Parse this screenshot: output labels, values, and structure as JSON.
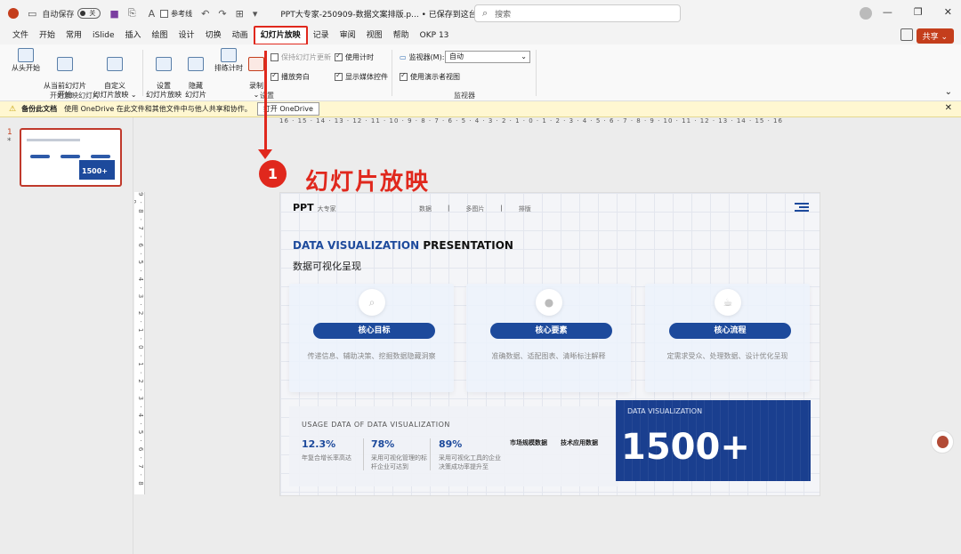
{
  "titlebar": {
    "autosave_label": "自动保存",
    "autosave_state": "关",
    "reference_line_label": "参考线",
    "doc_title": "PPT大专家-250909-数据文案排版.p... • 已保存到这台电脑 ⌄",
    "search_placeholder": "搜索"
  },
  "menu": {
    "tabs": [
      "文件",
      "开始",
      "常用",
      "iSlide",
      "插入",
      "绘图",
      "设计",
      "切换",
      "动画",
      "幻灯片放映",
      "记录",
      "审阅",
      "视图",
      "帮助",
      "OKP 13"
    ],
    "active": "幻灯片放映",
    "share_label": "共享"
  },
  "ribbon": {
    "from_start": "从头开始",
    "from_current": "从当前幻灯片\n开始",
    "custom_show": "自定义\n幻灯片放映 ⌄",
    "group_start": "开始放映幻灯片",
    "setup_show": "设置\n幻灯片放映",
    "hide_slide": "隐藏\n幻灯片",
    "rehearse": "排练计时",
    "record": "录制\n⌄",
    "keep_updated": "保持幻灯片更新",
    "play_narration": "播放旁白",
    "use_timing": "使用计时",
    "show_media": "显示媒体控件",
    "group_setup": "设置",
    "monitor_label": "监视器(M):",
    "monitor_value": "自动",
    "presenter_view": "使用演示者视图",
    "group_monitor": "监视器"
  },
  "notify": {
    "bold": "备份此文档",
    "text": "使用 OneDrive 在此文件和其他文件中与他人共享和协作。",
    "button": "打开 OneDrive"
  },
  "thumbnails": {
    "number": "1",
    "marker": "*",
    "big_number": "1500+"
  },
  "rulers": {
    "horizontal": "16 · 15 · 14 · 13 · 12 · 11 · 10 · 9 · 8 · 7 · 6 · 5 · 4 · 3 · 2 · 1 · 0 · 1 · 2 · 3 · 4 · 5 · 6 · 7 · 8 · 9 · 10 · 11 · 12 · 13 · 14 · 15 · 16",
    "vertical": "9 · 8 · 7 · 6 · 5 · 4 · 3 · 2 · 1 · 0 · 1 · 2 · 3 · 4 · 5 · 6 · 7 · 8 · 9"
  },
  "slide": {
    "logo": "PPT",
    "logo_sub": "大专家",
    "nav": [
      "数据",
      "多图片",
      "排版"
    ],
    "title_accent": "DATA VISUALIZATION",
    "title_rest": " PRESENTATION",
    "subtitle": "数据可视化呈现",
    "cards": [
      {
        "label": "核心目标",
        "desc": "传递信息、辅助决策、挖掘数据隐藏洞察"
      },
      {
        "label": "核心要素",
        "desc": "准确数据、适配图表、清晰标注解释"
      },
      {
        "label": "核心流程",
        "desc": "定需求受众、处理数据、设计优化呈现"
      }
    ],
    "usage_heading": "USAGE DATA OF DATA VISUALIZATION",
    "stats": [
      {
        "value": "12.3%",
        "desc": "年复合增长率高达"
      },
      {
        "value": "78%",
        "desc": "采用可视化管理的标杆企业可达到"
      },
      {
        "value": "89%",
        "desc": "采用可视化工具的企业决策成功率提升至"
      }
    ],
    "tags": [
      "市场规模数据",
      "技术应用数据"
    ],
    "blue_label": "DATA VISUALIZATION",
    "big_number": "1500+"
  },
  "annotation": {
    "step": "1",
    "label": "幻灯片放映"
  }
}
